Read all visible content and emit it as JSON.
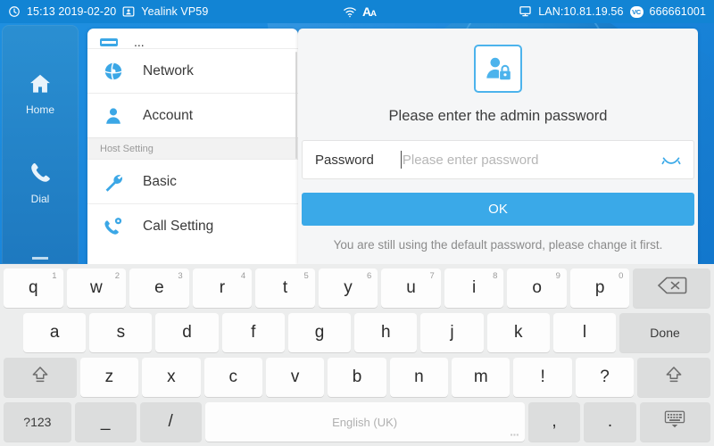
{
  "statusbar": {
    "clock_icon": "clock-icon",
    "time": "15:13 2019-02-20",
    "account_icon": "contact-card-icon",
    "device_name": "Yealink VP59",
    "wifi_icon": "wifi-icon",
    "font_icon": "text-size-icon",
    "lan_icon": "monitor-icon",
    "lan": "LAN:10.81.19.56",
    "vc_badge": "VC",
    "phone_number": "666661001",
    "bg_color": "#1284d4"
  },
  "sidebar": {
    "items": [
      {
        "label": "Home",
        "icon": "home-icon"
      },
      {
        "label": "Dial",
        "icon": "phone-icon"
      }
    ]
  },
  "menu": {
    "cut_label": "...",
    "items": [
      {
        "label": "Network",
        "icon": "globe-network-icon"
      },
      {
        "label": "Account",
        "icon": "person-icon"
      }
    ],
    "section_label": "Host Setting",
    "host_items": [
      {
        "label": "Basic",
        "icon": "wrench-icon"
      },
      {
        "label": "Call Setting",
        "icon": "phone-gear-icon"
      }
    ]
  },
  "dialog": {
    "avatar_icon": "user-lock-icon",
    "title": "Please enter the admin password",
    "password_label": "Password",
    "password_value": "",
    "password_placeholder": "Please enter password",
    "eye_icon": "eye-closed-icon",
    "ok_label": "OK",
    "hint": "You are still using the default password, please change it first.",
    "accent_color": "#3aa9e8"
  },
  "keyboard": {
    "row1": [
      {
        "label": "q",
        "sup": "1"
      },
      {
        "label": "w",
        "sup": "2"
      },
      {
        "label": "e",
        "sup": "3"
      },
      {
        "label": "r",
        "sup": "4"
      },
      {
        "label": "t",
        "sup": "5"
      },
      {
        "label": "y",
        "sup": "6"
      },
      {
        "label": "u",
        "sup": "7"
      },
      {
        "label": "i",
        "sup": "8"
      },
      {
        "label": "o",
        "sup": "9"
      },
      {
        "label": "p",
        "sup": "0"
      }
    ],
    "backspace_icon": "backspace-icon",
    "row2": [
      {
        "label": "a"
      },
      {
        "label": "s"
      },
      {
        "label": "d"
      },
      {
        "label": "f"
      },
      {
        "label": "g"
      },
      {
        "label": "h"
      },
      {
        "label": "j"
      },
      {
        "label": "k"
      },
      {
        "label": "l"
      }
    ],
    "done_label": "Done",
    "shift_icon": "shift-icon",
    "row3": [
      {
        "label": "z"
      },
      {
        "label": "x"
      },
      {
        "label": "c"
      },
      {
        "label": "v"
      },
      {
        "label": "b"
      },
      {
        "label": "n"
      },
      {
        "label": "m"
      },
      {
        "label": "!"
      },
      {
        "label": "?"
      }
    ],
    "symbols_label": "?123",
    "underscore_label": "_",
    "slash_label": "/",
    "space_label": "English (UK)",
    "comma_label": ",",
    "period_label": ".",
    "hide_keyboard_icon": "hide-keyboard-icon"
  }
}
